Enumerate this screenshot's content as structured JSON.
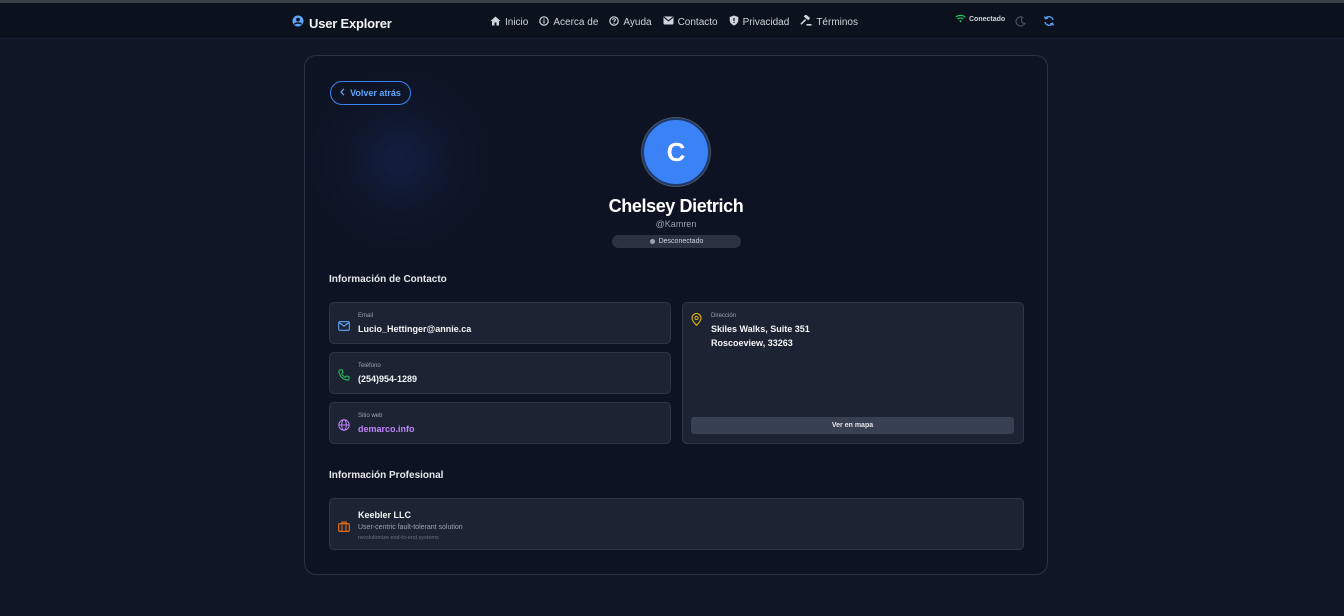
{
  "brand": {
    "title": "User Explorer",
    "icon": "user-circle-icon"
  },
  "nav": {
    "links": [
      {
        "label": "Inicio",
        "icon": "home-icon"
      },
      {
        "label": "Acerca de",
        "icon": "info-icon"
      },
      {
        "label": "Ayuda",
        "icon": "help-icon"
      },
      {
        "label": "Contacto",
        "icon": "mail-icon"
      },
      {
        "label": "Privacidad",
        "icon": "shield-icon"
      },
      {
        "label": "Términos",
        "icon": "gavel-icon"
      }
    ],
    "connection_status": "Conectado"
  },
  "profile": {
    "back_label": "Volver atrás",
    "avatar_initial": "C",
    "name": "Chelsey Dietrich",
    "username": "@Kamren",
    "status": "Desconectado"
  },
  "contact": {
    "section_title": "Información de Contacto",
    "email_label": "Email",
    "email": "Lucio_Hettinger@annie.ca",
    "phone_label": "Teléfono",
    "phone": "(254)954-1289",
    "website_label": "Sitio web",
    "website": "demarco.info",
    "address_label": "Dirección",
    "address_line1": "Skiles Walks, Suite 351",
    "address_line2": "Roscoeview, 33263",
    "map_button": "Ver en mapa"
  },
  "professional": {
    "section_title": "Información Profesional",
    "company": "Keebler LLC",
    "catch_phrase": "User-centric fault-tolerant solution",
    "bs": "revolutionize end-to-end systems"
  },
  "colors": {
    "accent": "#3b82f6",
    "email_icon": "#60a5fa",
    "phone_icon": "#22c55e",
    "website": "#c084fc",
    "address_icon": "#eab308",
    "company_icon": "#f97316",
    "online": "#22c55e"
  }
}
